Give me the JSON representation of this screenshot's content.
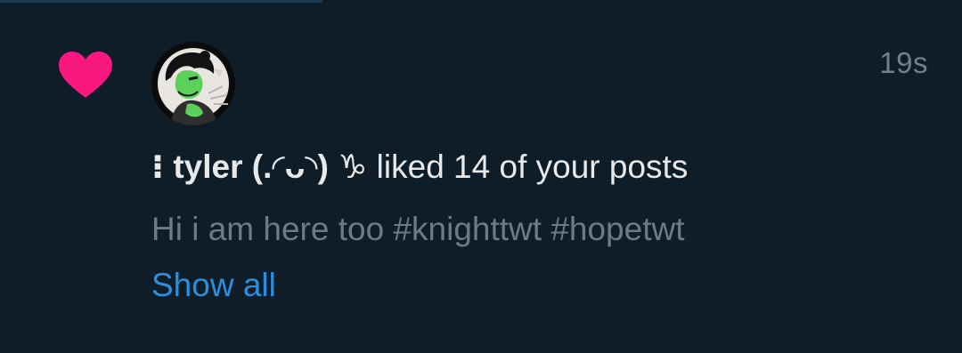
{
  "notification": {
    "type_icon": "heart-icon",
    "timestamp": "19s",
    "user_name": "⁝ tyler (.◜ᴗ◝) ♑︎",
    "action_text": " liked 14 of your posts",
    "post_text": "Hi i am here too #knighttwt #hopetwt",
    "show_all_label": "Show all"
  },
  "colors": {
    "background": "#0f1d29",
    "heart": "#f91880",
    "primary_text": "#e7e9ea",
    "secondary_text": "#6c7b87",
    "link": "#2b8fdd"
  }
}
